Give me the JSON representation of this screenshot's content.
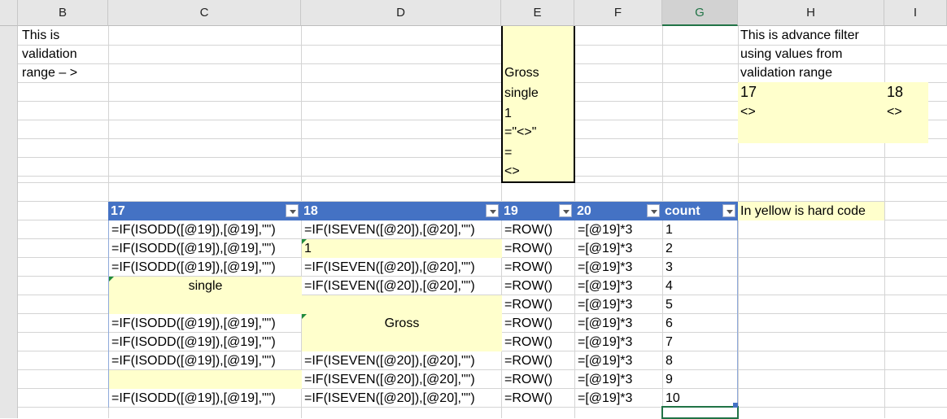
{
  "columns": [
    "B",
    "C",
    "D",
    "E",
    "F",
    "G",
    "H",
    "I"
  ],
  "notes": {
    "validation_label": [
      "This is",
      "validation",
      "range – >"
    ],
    "advance_filter": [
      "This is advance filter",
      "using values from",
      "validation range"
    ],
    "yellow_note": "In yellow is hard code"
  },
  "validation_range": [
    "Gross",
    "single",
    "1",
    "=\"<>\"",
    "=",
    "<>"
  ],
  "filter_criteria": {
    "h_header": "17",
    "i_header": "18",
    "h_value": "<>",
    "i_value": "<>"
  },
  "table": {
    "headers": [
      "17",
      "18",
      "19",
      "20",
      "count"
    ],
    "rows": [
      [
        "=IF(ISODD([@19]),[@19],\"\")",
        "=IF(ISEVEN([@20]),[@20],\"\")",
        "=ROW()",
        "=[@19]*3",
        "1"
      ],
      [
        "=IF(ISODD([@19]),[@19],\"\")",
        "1",
        "=ROW()",
        "=[@19]*3",
        "2"
      ],
      [
        "=IF(ISODD([@19]),[@19],\"\")",
        "=IF(ISEVEN([@20]),[@20],\"\")",
        "=ROW()",
        "=[@19]*3",
        "3"
      ],
      [
        "single",
        "=IF(ISEVEN([@20]),[@20],\"\")",
        "=ROW()",
        "=[@19]*3",
        "4"
      ],
      [
        "",
        "",
        "=ROW()",
        "=[@19]*3",
        "5"
      ],
      [
        "=IF(ISODD([@19]),[@19],\"\")",
        "Gross",
        "=ROW()",
        "=[@19]*3",
        "6"
      ],
      [
        "=IF(ISODD([@19]),[@19],\"\")",
        "",
        "=ROW()",
        "=[@19]*3",
        "7"
      ],
      [
        "=IF(ISODD([@19]),[@19],\"\")",
        "=IF(ISEVEN([@20]),[@20],\"\")",
        "=ROW()",
        "=[@19]*3",
        "8"
      ],
      [
        "",
        "=IF(ISEVEN([@20]),[@20],\"\")",
        "=ROW()",
        "=[@19]*3",
        "9"
      ],
      [
        "=IF(ISODD([@19]),[@19],\"\")",
        "=IF(ISEVEN([@20]),[@20],\"\")",
        "=ROW()",
        "=[@19]*3",
        "10"
      ]
    ],
    "yellow_cells": [
      [
        1,
        1
      ],
      [
        3,
        0
      ],
      [
        4,
        0
      ],
      [
        4,
        1
      ],
      [
        5,
        1
      ],
      [
        6,
        1
      ],
      [
        8,
        0
      ]
    ],
    "center_cells": [
      [
        3,
        0
      ],
      [
        5,
        1
      ]
    ]
  },
  "colors": {
    "table_header": "#4472c4",
    "hard_code": "#ffffcc",
    "selection": "#217346"
  }
}
